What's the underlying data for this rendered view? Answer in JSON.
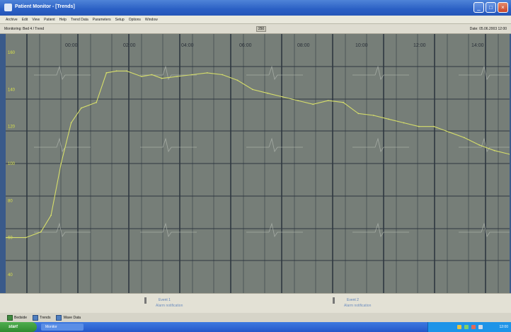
{
  "window": {
    "title": "Patient Monitor - [Trends]",
    "buttons": {
      "minimize": "_",
      "maximize": "□",
      "close": "×"
    }
  },
  "menu": {
    "items": [
      "Archive",
      "Edit",
      "View",
      "Patient",
      "Help",
      "Trend Data",
      "Parameters",
      "Setup",
      "Options",
      "Window"
    ]
  },
  "status": {
    "patient": "Monitoring: Bed 4 / Trend",
    "center_badge": "250",
    "clock": "Date: 05.06.2003 12:00"
  },
  "plot": {
    "colors": {
      "background": "#767e78",
      "grid": "#2e3740",
      "trace": "#d6de6a",
      "labels": "#d9e24a"
    },
    "time_labels": [
      "00:00",
      "02:00",
      "04:00",
      "06:00",
      "08:00",
      "10:00",
      "12:00",
      "14:00"
    ],
    "y_labels": [
      "160",
      "140",
      "120",
      "100",
      "80",
      "60",
      "40"
    ]
  },
  "chart_data": {
    "type": "line",
    "series": [
      {
        "x": [
          0,
          4,
          7,
          9,
          11,
          13,
          15,
          18,
          20,
          22,
          24,
          27,
          29,
          31,
          34,
          37,
          40,
          43,
          46,
          49,
          52,
          55,
          58,
          61,
          64,
          67,
          70,
          73,
          76,
          79,
          82,
          85,
          88,
          91,
          94,
          97,
          100
        ],
        "values": [
          60,
          60,
          63,
          72,
          100,
          122,
          130,
          133,
          149,
          150,
          150,
          147,
          148,
          146,
          147,
          148,
          149,
          148,
          145,
          140,
          138,
          136,
          134,
          132,
          134,
          133,
          127,
          126,
          124,
          122,
          120,
          120,
          117,
          114,
          110,
          107,
          105
        ]
      }
    ],
    "xlim": [
      0,
      100
    ],
    "ylim": [
      30,
      170
    ]
  },
  "bottom": {
    "markers": [
      {
        "label": "Event 1",
        "sub": "Alarm notification"
      },
      {
        "label": "Event 2",
        "sub": "Alarm notification"
      }
    ]
  },
  "toolstrip": {
    "items": [
      "Bedside",
      "Trends",
      "Wave Data"
    ]
  },
  "taskbar": {
    "start_label": "start",
    "task_label": "Monitor",
    "clock": "12:00"
  }
}
